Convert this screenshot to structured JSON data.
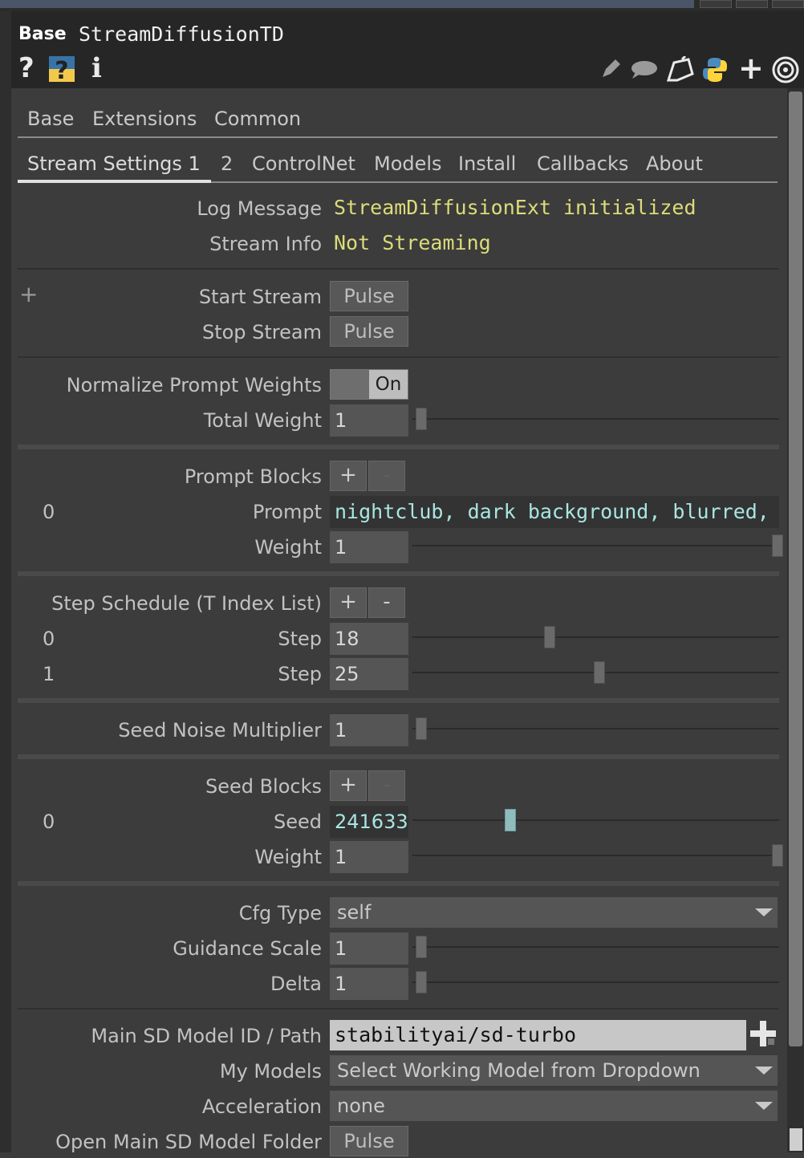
{
  "header": {
    "op_type": "Base",
    "op_name": "StreamDiffusionTD"
  },
  "toolbar": {
    "left_icons": [
      "help-icon",
      "python-help-icon",
      "info-icon"
    ],
    "right_icons": [
      "edit-icon",
      "comment-icon",
      "clone-icon",
      "python-icon",
      "plus-icon",
      "viewer-icon"
    ]
  },
  "page_tabs_row1": [
    "Base",
    "Extensions",
    "Common"
  ],
  "page_tabs_row2": {
    "active": "Stream Settings 1",
    "items": [
      "Stream Settings 1",
      "2",
      "ControlNet",
      "Models",
      "Install",
      "Callbacks",
      "About"
    ]
  },
  "params": {
    "log_message": {
      "label": "Log Message",
      "value": "StreamDiffusionExt initialized"
    },
    "stream_info": {
      "label": "Stream Info",
      "value": "Not Streaming"
    },
    "start_stream": {
      "label": "Start Stream",
      "button": "Pulse"
    },
    "stop_stream": {
      "label": "Stop Stream",
      "button": "Pulse"
    },
    "normalize": {
      "label": "Normalize Prompt Weights",
      "value": "On"
    },
    "total_weight": {
      "label": "Total Weight",
      "value": "1",
      "slider": 0.0
    },
    "prompt_blocks": {
      "label": "Prompt Blocks",
      "plus": "+",
      "minus": "-"
    },
    "prompt0": {
      "index": "0",
      "label": "Prompt",
      "value": "nightclub, dark background, blurred,",
      "weight_label": "Weight",
      "weight": "1",
      "weight_slider": 1.0
    },
    "step_schedule": {
      "label": "Step Schedule (T Index List)",
      "plus": "+",
      "minus": "-"
    },
    "steps": [
      {
        "index": "0",
        "label": "Step",
        "value": "18",
        "slider": 0.36
      },
      {
        "index": "1",
        "label": "Step",
        "value": "25",
        "slider": 0.5
      }
    ],
    "seed_noise": {
      "label": "Seed Noise Multiplier",
      "value": "1",
      "slider": 0.0
    },
    "seed_blocks": {
      "label": "Seed Blocks",
      "plus": "+",
      "minus": "-"
    },
    "seed0": {
      "index": "0",
      "label": "Seed",
      "value": "241633",
      "slider": 0.25,
      "weight_label": "Weight",
      "weight": "1",
      "weight_slider": 1.0
    },
    "cfg_type": {
      "label": "Cfg Type",
      "value": "self"
    },
    "guidance_scale": {
      "label": "Guidance Scale",
      "value": "1",
      "slider": 0.0
    },
    "delta": {
      "label": "Delta",
      "value": "1",
      "slider": 0.0
    },
    "model_id": {
      "label": "Main SD Model ID / Path",
      "value": "stabilityai/sd-turbo"
    },
    "my_models": {
      "label": "My Models",
      "value": "Select Working Model from Dropdown"
    },
    "acceleration": {
      "label": "Acceleration",
      "value": "none"
    },
    "open_folder": {
      "label": "Open Main SD Model Folder",
      "button": "Pulse"
    }
  },
  "colors": {
    "panel_bg": "#3c3c3c",
    "header_bg": "#262626",
    "field_bg": "#555555",
    "yellow_text": "#dcdc7a",
    "cyan_text": "#a8e6e2",
    "seed_thumb": "#8fbcbc"
  }
}
